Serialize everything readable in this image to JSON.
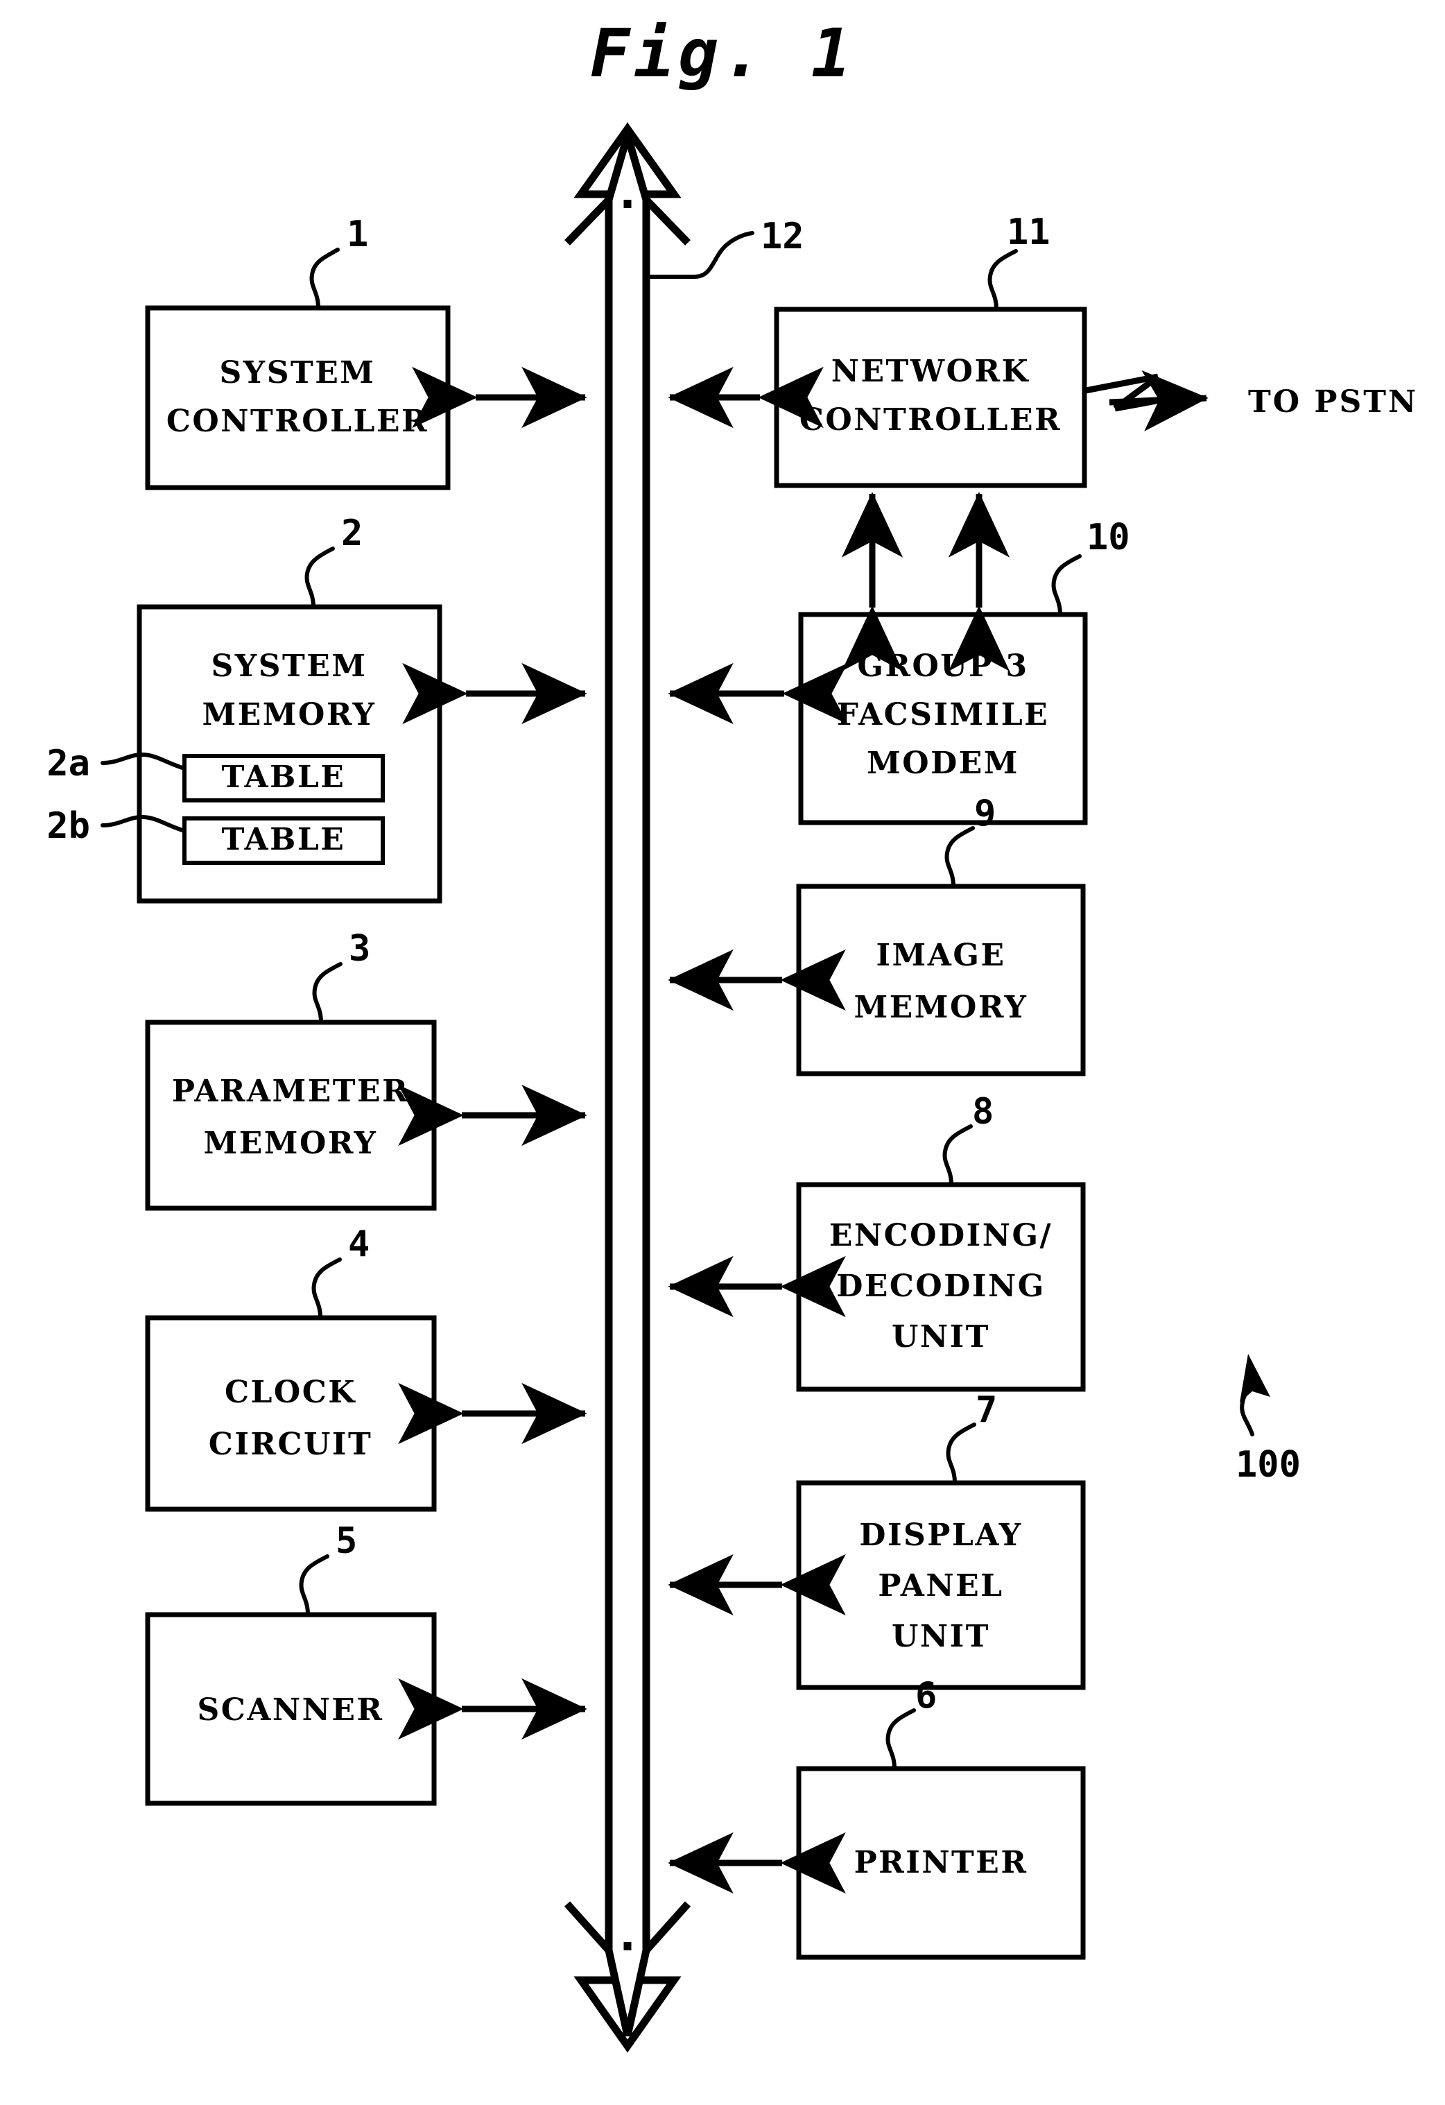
{
  "figure": {
    "title": "Fig. 1",
    "system_ref": "100",
    "bus_ref": "12",
    "external_label": "TO PSTN"
  },
  "left_blocks": [
    {
      "id": "system-controller",
      "ref": "1",
      "lines": [
        "SYSTEM",
        "CONTROLLER"
      ]
    },
    {
      "id": "system-memory",
      "ref": "2",
      "lines": [
        "SYSTEM",
        "MEMORY"
      ]
    },
    {
      "id": "parameter-memory",
      "ref": "3",
      "lines": [
        "PARAMETER",
        "MEMORY"
      ]
    },
    {
      "id": "clock-circuit",
      "ref": "4",
      "lines": [
        "CLOCK",
        "CIRCUIT"
      ]
    },
    {
      "id": "scanner",
      "ref": "5",
      "lines": [
        "SCANNER"
      ]
    }
  ],
  "right_blocks": [
    {
      "id": "network-controller",
      "ref": "11",
      "lines": [
        "NETWORK",
        "CONTROLLER"
      ]
    },
    {
      "id": "group3-fax-modem",
      "ref": "10",
      "lines": [
        "GROUP 3",
        "FACSIMILE",
        "MODEM"
      ]
    },
    {
      "id": "image-memory",
      "ref": "9",
      "lines": [
        "IMAGE",
        "MEMORY"
      ]
    },
    {
      "id": "encoding-decoding",
      "ref": "8",
      "lines": [
        "ENCODING/",
        "DECODING",
        "UNIT"
      ]
    },
    {
      "id": "display-panel",
      "ref": "7",
      "lines": [
        "DISPLAY",
        "PANEL",
        "UNIT"
      ]
    },
    {
      "id": "printer",
      "ref": "6",
      "lines": [
        "PRINTER"
      ]
    }
  ],
  "memory_tables": [
    {
      "id": "table-2a",
      "ref": "2a",
      "label": "TABLE"
    },
    {
      "id": "table-2b",
      "ref": "2b",
      "label": "TABLE"
    }
  ],
  "colors": {
    "ink": "#000000",
    "paper": "#ffffff"
  }
}
